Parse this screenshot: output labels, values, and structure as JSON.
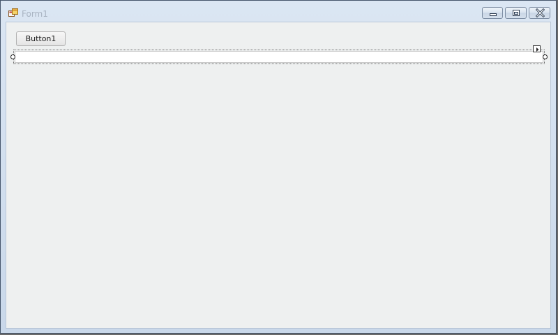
{
  "window": {
    "title": "Form1",
    "app_icon": "form-icon",
    "caption_buttons": [
      "minimize-icon",
      "maximize-icon",
      "close-icon"
    ]
  },
  "form": {
    "button1_label": "Button1",
    "textbox_value": ""
  },
  "colors": {
    "title_text": "#a9b4c2",
    "client_background": "#eef0f0",
    "frame": "#c9d8ea"
  }
}
